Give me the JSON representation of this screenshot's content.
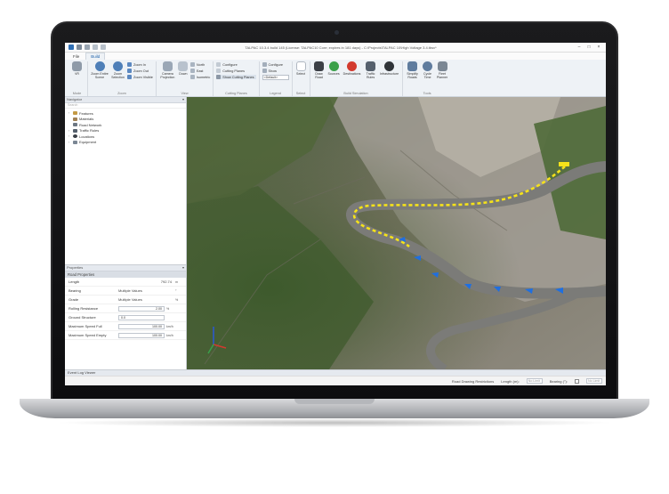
{
  "app": {
    "title": "TALPAC 10.3.4 build 145 (License: TALPAC10 Core; expires in 181 days) - C:\\Projects\\TALPAC 10\\High Voltage 3.4.tbsv*"
  },
  "tabs": [
    {
      "label": "File"
    },
    {
      "label": "Build"
    }
  ],
  "ribbon": {
    "mode": {
      "group_label": "Mode",
      "vr_label": "VR"
    },
    "zoom": {
      "group_label": "Zoom",
      "zoom_entire_scene": "Zoom Entire Scene",
      "zoom_selection": "Zoom Selection",
      "zoom_in": "Zoom In",
      "zoom_out": "Zoom Out",
      "zoom_visible": "Zoom Visible"
    },
    "view": {
      "group_label": "View",
      "camera_projection": "Camera Projection",
      "down": "Down",
      "north": "North",
      "east": "East",
      "isometric": "Isometric"
    },
    "cutting_planes": {
      "group_label": "Cutting Planes",
      "configure": "Configure",
      "cutting_planes": "Cutting Planes",
      "show_cutting_planes": "Show Cutting Planes"
    },
    "legend": {
      "group_label": "Legend",
      "configure": "Configure",
      "show": "Show",
      "selected": "<Default>"
    },
    "select": {
      "group_label": "Select",
      "select": "Select"
    },
    "build_simulation": {
      "group_label": "Build Simulation",
      "draw_road": "Draw Road",
      "sources": "Sources",
      "destinations": "Destinations",
      "traffic_rules": "Traffic Rules",
      "infrastructure": "Infrastructure"
    },
    "tools": {
      "group_label": "Tools",
      "simplify_roads": "Simplify Roads",
      "cycle_time": "Cycle Time",
      "fleet_planner": "Fleet Planner"
    }
  },
  "navigator": {
    "header": "Navigator",
    "search_placeholder": "Search",
    "items": [
      {
        "label": "Features"
      },
      {
        "label": "Materials"
      },
      {
        "label": "Road Network"
      },
      {
        "label": "Traffic Rules"
      },
      {
        "label": "Locations"
      },
      {
        "label": "Equipment"
      }
    ]
  },
  "properties": {
    "header": "Properties",
    "section": "Road Properties",
    "rows": [
      {
        "name": "Length",
        "value": "792.74",
        "unit": "m"
      },
      {
        "name": "Bearing",
        "value": "Multiple Values",
        "unit": "°"
      },
      {
        "name": "Grade",
        "value": "Multiple Values",
        "unit": "%"
      },
      {
        "name": "Rolling Resistance",
        "value": "2.00",
        "unit": "%"
      },
      {
        "name": "Ground Structure",
        "value": "0.0",
        "unit": ""
      },
      {
        "name": "Maximum Speed Full",
        "value": "100.00",
        "unit": "km/h"
      },
      {
        "name": "Maximum Speed Empty",
        "value": "100.00",
        "unit": "km/h"
      }
    ]
  },
  "event_log": {
    "label": "Event Log Viewer"
  },
  "status_bar": {
    "road_drawing_restrictions": "Road Drawing Restrictions",
    "length_label": "Length (m):",
    "length_placeholder": "No Limit",
    "bearing_label": "Bearing (°):",
    "bearing_placeholder": "No Limit"
  },
  "colors": {
    "accent": "#1a5fa8",
    "road_selection": "#f5e21a",
    "traffic_markers": "#1f6fe0"
  }
}
